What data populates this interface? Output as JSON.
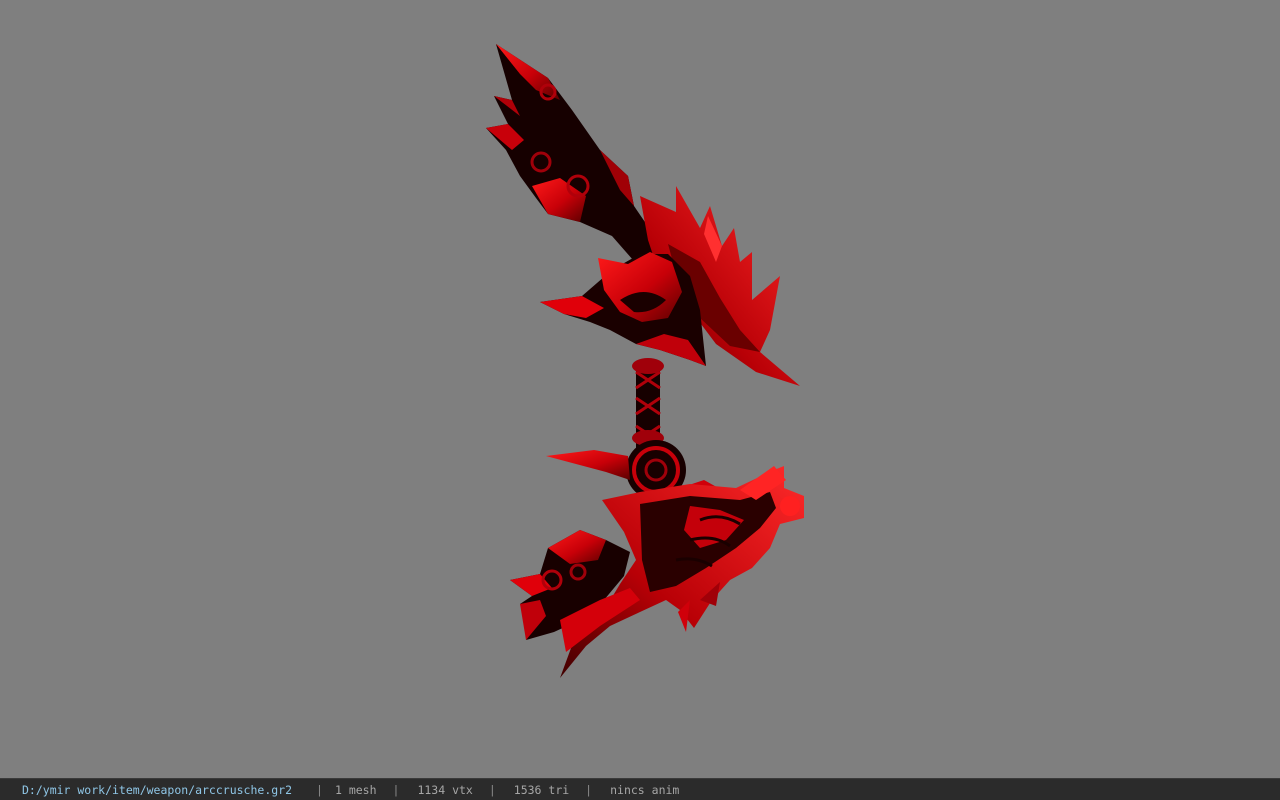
{
  "viewport": {
    "background": "#7f7f7f",
    "model": {
      "name": "arccrusche",
      "palette": {
        "red": "#d3000a",
        "dark": "#140000",
        "mid": "#8a0006"
      }
    }
  },
  "status_bar": {
    "file_path": "D:/ymir work/item/weapon/arccrusche.gr2",
    "separator": "|",
    "mesh_count": "1 mesh",
    "vertex_count": "1134 vtx",
    "triangle_count": "1536 tri",
    "animation": "nincs anim"
  }
}
